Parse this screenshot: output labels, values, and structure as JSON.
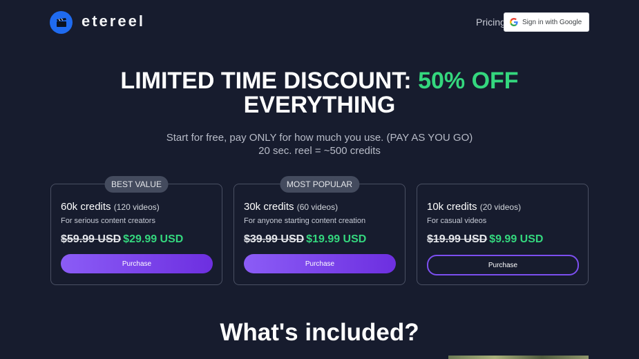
{
  "header": {
    "brand": "etereel",
    "nav_pricing": "Pricing",
    "google_signin": "Sign in with Google"
  },
  "hero": {
    "title_part1": "LIMITED TIME DISCOUNT: ",
    "title_accent": "50% OFF",
    "title_part2": "EVERYTHING",
    "subtitle_line1": "Start for free, pay ONLY for how much you use. (PAY AS YOU GO)",
    "subtitle_line2": "20 sec. reel = ~500 credits"
  },
  "plans": [
    {
      "badge": "BEST VALUE",
      "credits": "60k credits",
      "videos": "(120 videos)",
      "description": "For serious content creators",
      "old_price": "$59.99 USD",
      "new_price": "$29.99 USD",
      "button": "Purchase"
    },
    {
      "badge": "MOST POPULAR",
      "credits": "30k credits",
      "videos": "(60 videos)",
      "description": "For anyone starting content creation",
      "old_price": "$39.99 USD",
      "new_price": "$19.99 USD",
      "button": "Purchase"
    },
    {
      "badge": "",
      "credits": "10k credits",
      "videos": "(20 videos)",
      "description": "For casual videos",
      "old_price": "$19.99 USD",
      "new_price": "$9.99 USD",
      "button": "Purchase"
    }
  ],
  "included_heading": "What's included?",
  "colors": {
    "background": "#171c2e",
    "accent_green": "#34d77e",
    "brand_blue": "#1f6bf0",
    "purchase_purple": "#7c4ff0"
  }
}
